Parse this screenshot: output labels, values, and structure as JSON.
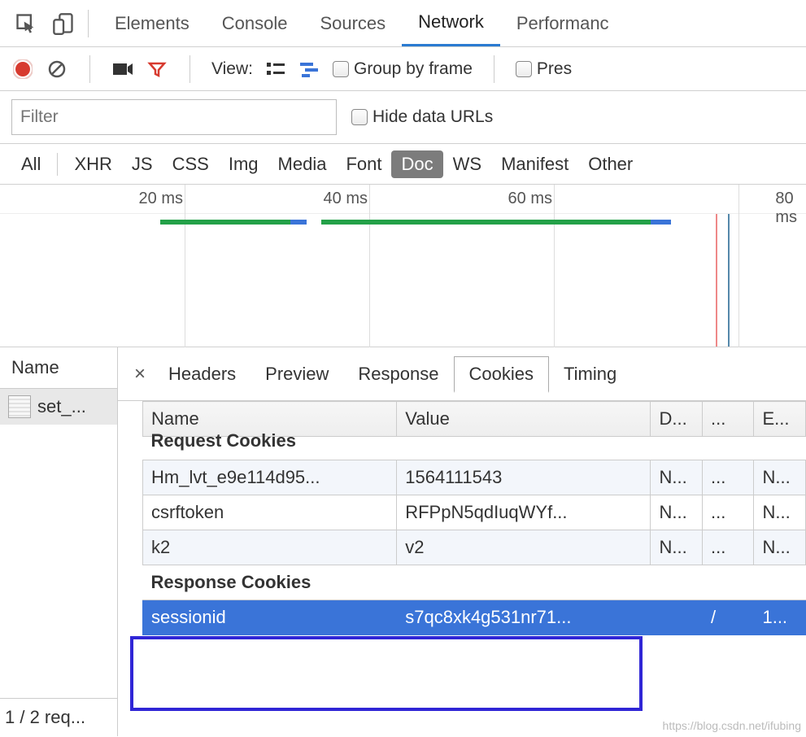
{
  "tabs": {
    "elements": "Elements",
    "console": "Console",
    "sources": "Sources",
    "network": "Network",
    "performance": "Performanc"
  },
  "toolbar": {
    "view_label": "View:",
    "group_by_frame": "Group by frame",
    "preserve": "Pres"
  },
  "filter": {
    "placeholder": "Filter",
    "hide_data_urls": "Hide data URLs"
  },
  "types": [
    "All",
    "XHR",
    "JS",
    "CSS",
    "Img",
    "Media",
    "Font",
    "Doc",
    "WS",
    "Manifest",
    "Other"
  ],
  "timeline": {
    "ticks": [
      "20 ms",
      "40 ms",
      "60 ms",
      "80 ms"
    ]
  },
  "left": {
    "col": "Name",
    "item": "set_...",
    "footer": "1 / 2 req..."
  },
  "ptabs": [
    "Headers",
    "Preview",
    "Response",
    "Cookies",
    "Timing"
  ],
  "cookie_table": {
    "headers": [
      "Name",
      "Value",
      "D...",
      "...",
      "E..."
    ],
    "request_section": "Request Cookies",
    "response_section": "Response Cookies",
    "request_rows": [
      {
        "name": "Hm_lvt_e9e114d95...",
        "value": "1564111543",
        "d": "N...",
        "p": "...",
        "e": "N..."
      },
      {
        "name": "csrftoken",
        "value": "RFPpN5qdIuqWYf...",
        "d": "N...",
        "p": "...",
        "e": "N..."
      },
      {
        "name": "k2",
        "value": "v2",
        "d": "N...",
        "p": "...",
        "e": "N..."
      }
    ],
    "response_rows": [
      {
        "name": "sessionid",
        "value": "s7qc8xk4g531nr71...",
        "d": "",
        "p": "/",
        "e": "1..."
      }
    ]
  },
  "watermark": "https://blog.csdn.net/ifubing"
}
